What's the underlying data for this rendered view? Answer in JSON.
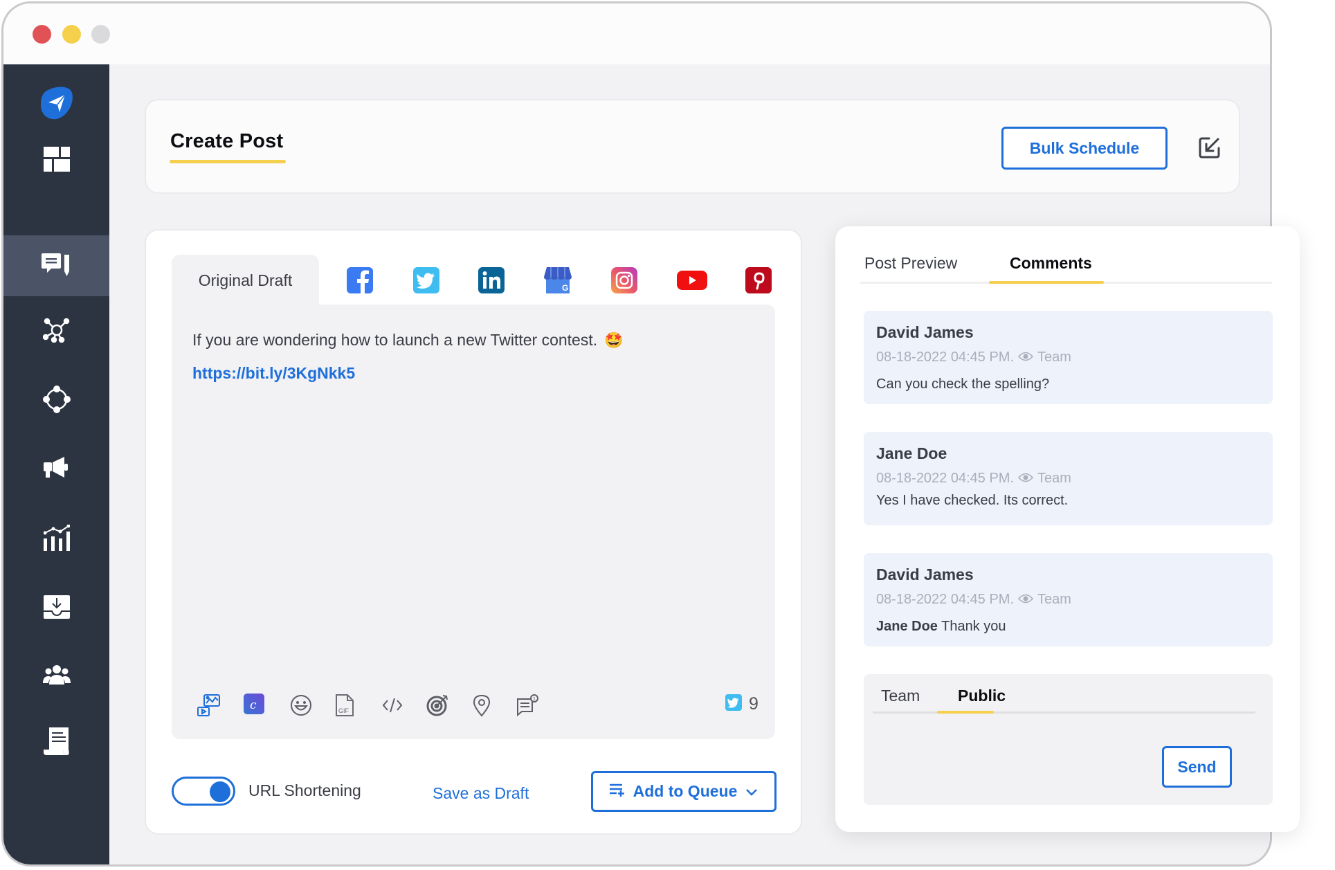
{
  "window": {
    "controls": [
      "close",
      "minimize",
      "maximize"
    ]
  },
  "sidebar": {
    "items": [
      {
        "name": "logo",
        "icon": "paper-plane-icon",
        "active": false
      },
      {
        "name": "dashboard",
        "icon": "dashboard-grid-icon",
        "active": false
      },
      {
        "name": "compose",
        "icon": "compose-post-icon",
        "active": true
      },
      {
        "name": "social-network",
        "icon": "network-hub-icon",
        "active": false
      },
      {
        "name": "integrations",
        "icon": "circle-nodes-icon",
        "active": false
      },
      {
        "name": "campaigns",
        "icon": "megaphone-icon",
        "active": false
      },
      {
        "name": "analytics",
        "icon": "analytics-chart-icon",
        "active": false
      },
      {
        "name": "inbox",
        "icon": "inbox-download-icon",
        "active": false
      },
      {
        "name": "team",
        "icon": "team-users-icon",
        "active": false
      },
      {
        "name": "reports",
        "icon": "report-scroll-icon",
        "active": false
      }
    ]
  },
  "header": {
    "title": "Create Post",
    "bulk_schedule_label": "Bulk Schedule",
    "export_icon": "export-arrow-icon"
  },
  "editor": {
    "draft_tab_label": "Original Draft",
    "networks": [
      "facebook",
      "twitter",
      "linkedin",
      "google-my-business",
      "instagram",
      "youtube",
      "pinterest"
    ],
    "post_text": "If you are wondering how to launch a new Twitter contest.",
    "post_emoji": "🤩",
    "post_link": "https://bit.ly/3KgNkk5",
    "toolbar_icons": [
      "media-icon",
      "canva-icon",
      "emoji-icon",
      "gif-icon",
      "code-icon",
      "target-icon",
      "location-icon",
      "comment-note-icon"
    ],
    "twitter_char_count": "9",
    "url_shortening_label": "URL Shortening",
    "url_shortening_enabled": true,
    "save_draft_label": "Save as Draft",
    "add_queue_label": "Add to Queue"
  },
  "comments_panel": {
    "tabs": [
      {
        "label": "Post Preview",
        "active": false
      },
      {
        "label": "Comments",
        "active": true
      }
    ],
    "comments": [
      {
        "author": "David James",
        "timestamp": "08-18-2022 04:45 PM.",
        "visibility": "Team",
        "mention": "",
        "text": "Can you check the spelling?"
      },
      {
        "author": "Jane Doe",
        "timestamp": "08-18-2022 04:45 PM.",
        "visibility": "Team",
        "mention": "",
        "text": "Yes I have checked. Its correct."
      },
      {
        "author": "David James",
        "timestamp": "08-18-2022 04:45 PM.",
        "visibility": "Team",
        "mention": "Jane Doe",
        "text": "Thank you"
      }
    ],
    "reply": {
      "tabs": [
        {
          "label": "Team",
          "active": false
        },
        {
          "label": "Public",
          "active": true
        }
      ],
      "send_label": "Send"
    }
  },
  "colors": {
    "accent_blue": "#1e6fd9",
    "highlight_yellow": "#f5cf4e",
    "sidebar_bg": "#2c3441",
    "sidebar_active": "#4b5466",
    "comment_bg": "#edf2fb"
  }
}
